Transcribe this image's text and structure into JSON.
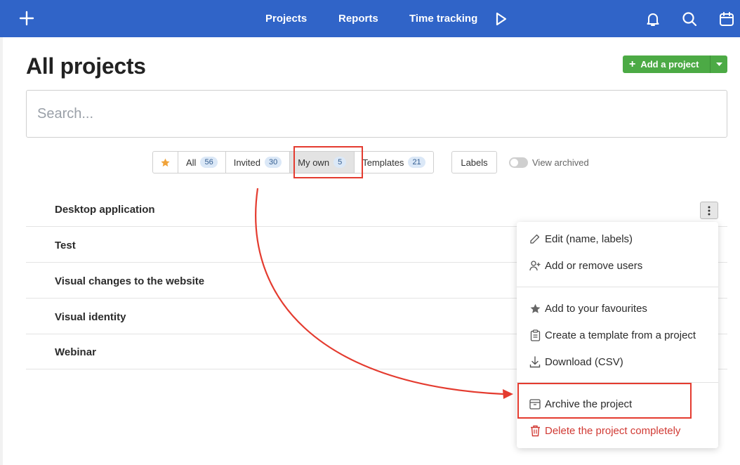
{
  "topbar": {
    "nav": [
      "Projects",
      "Reports",
      "Time tracking"
    ],
    "icons": [
      "plus-icon",
      "play-icon",
      "bell-icon",
      "search-icon",
      "calendar-icon"
    ]
  },
  "page": {
    "title": "All projects",
    "add_button": "Add a project"
  },
  "search": {
    "placeholder": "Search..."
  },
  "filters": {
    "all": {
      "label": "All",
      "count": "56"
    },
    "invited": {
      "label": "Invited",
      "count": "30"
    },
    "my_own": {
      "label": "My own",
      "count": "5"
    },
    "templates": {
      "label": "Templates",
      "count": "21"
    },
    "labels": "Labels",
    "view_archived": "View archived"
  },
  "projects": [
    "Desktop application",
    "Test",
    "Visual changes to the website",
    "Visual identity",
    "Webinar"
  ],
  "context_menu": {
    "edit": "Edit (name, labels)",
    "users": "Add or remove users",
    "favourite": "Add to your favourites",
    "template": "Create a template from a project",
    "download": "Download (CSV)",
    "archive": "Archive the project",
    "delete": "Delete the project completely"
  },
  "colors": {
    "topbar": "#3064c8",
    "add_button": "#4caa45",
    "highlight": "#e43b2f",
    "danger": "#d13a34"
  }
}
